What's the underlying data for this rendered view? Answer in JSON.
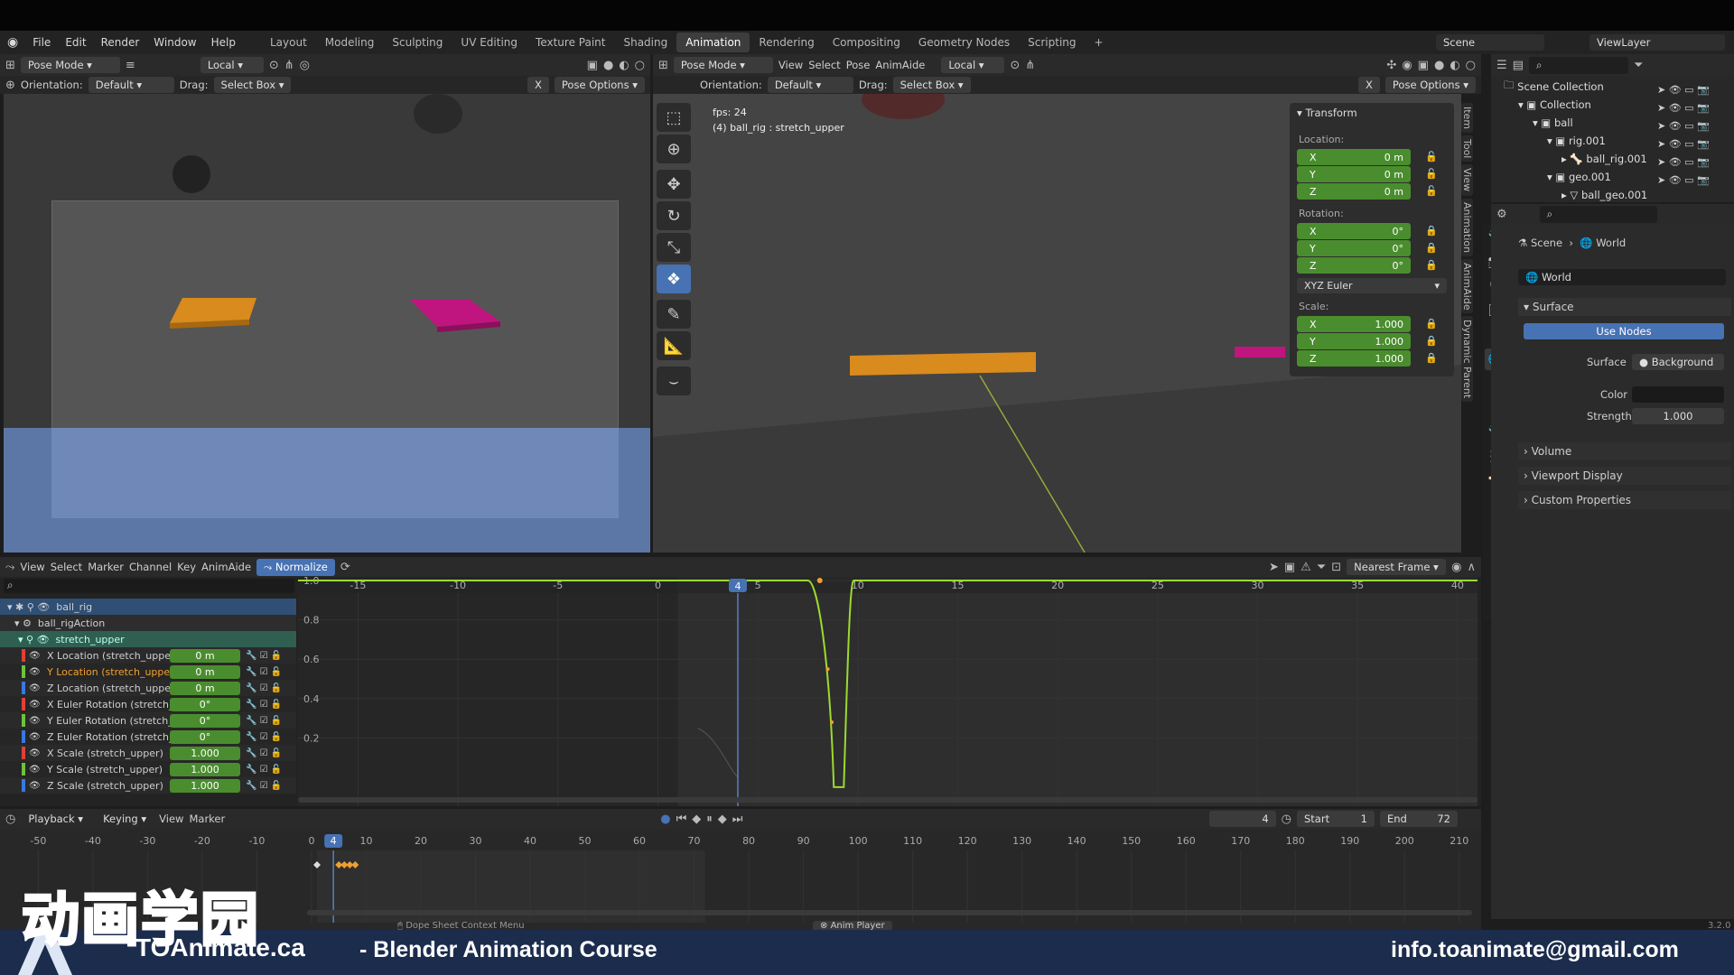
{
  "menubar": {
    "items": [
      "File",
      "Edit",
      "Render",
      "Window",
      "Help"
    ],
    "workspaces": [
      "Layout",
      "Modeling",
      "Sculpting",
      "UV Editing",
      "Texture Paint",
      "Shading",
      "Animation",
      "Rendering",
      "Compositing",
      "Geometry Nodes",
      "Scripting"
    ],
    "active_workspace": "Animation",
    "scene": "Scene",
    "view_layer": "ViewLayer",
    "plus": "+"
  },
  "left_viewport": {
    "mode": "Pose Mode",
    "transform": "Local",
    "orientation_label": "Orientation:",
    "orientation": "Default",
    "drag_label": "Drag:",
    "drag": "Select Box",
    "pose_options": "Pose Options",
    "axis": "X"
  },
  "right_viewport": {
    "mode": "Pose Mode",
    "menus": [
      "View",
      "Select",
      "Pose",
      "AnimAide"
    ],
    "transform": "Local",
    "orientation_label": "Orientation:",
    "orientation": "Default",
    "drag_label": "Drag:",
    "drag": "Select Box",
    "pose_options": "Pose Options",
    "axis": "X",
    "overlay_fps": "fps: 24",
    "overlay_obj": "(4) ball_rig : stretch_upper"
  },
  "transform_panel": {
    "title": "Transform",
    "location_label": "Location:",
    "rotation_label": "Rotation:",
    "scale_label": "Scale:",
    "location": [
      {
        "axis": "X",
        "value": "0 m"
      },
      {
        "axis": "Y",
        "value": "0 m"
      },
      {
        "axis": "Z",
        "value": "0 m"
      }
    ],
    "rotation": [
      {
        "axis": "X",
        "value": "0°"
      },
      {
        "axis": "Y",
        "value": "0°"
      },
      {
        "axis": "Z",
        "value": "0°"
      }
    ],
    "rotation_mode": "XYZ Euler",
    "scale": [
      {
        "axis": "X",
        "value": "1.000"
      },
      {
        "axis": "Y",
        "value": "1.000"
      },
      {
        "axis": "Z",
        "value": "1.000"
      }
    ]
  },
  "side_tabs": [
    "Item",
    "Tool",
    "View",
    "Animation",
    "AnimAide",
    "Dynamic Parent"
  ],
  "outliner": {
    "root": "Scene Collection",
    "rows": [
      "Collection",
      "ball",
      "rig.001",
      "ball_rig.001",
      "geo.001",
      "ball_geo.001"
    ]
  },
  "properties": {
    "breadcrumb_scene": "Scene",
    "breadcrumb_world": "World",
    "world_name": "World",
    "surface_section": "Surface",
    "use_nodes": "Use Nodes",
    "surface_label": "Surface",
    "surface_value": "Background",
    "color_label": "Color",
    "strength_label": "Strength",
    "strength_value": "1.000",
    "sections": [
      "Volume",
      "Viewport Display",
      "Custom Properties"
    ],
    "version": "3.2.0"
  },
  "graph_editor": {
    "menus": [
      "View",
      "Select",
      "Marker",
      "Channel",
      "Key",
      "AnimAide"
    ],
    "normalize": "Normalize",
    "snap": "Nearest Frame",
    "frame_ticks": [
      "-15",
      "-10",
      "-5",
      "0",
      "5",
      "10",
      "15",
      "20",
      "25",
      "30",
      "35",
      "40"
    ],
    "current_frame": "4",
    "y_ticks": [
      "1.0",
      "0.8",
      "0.6",
      "0.4",
      "0.2"
    ],
    "channels": {
      "rig": "ball_rig",
      "action": "ball_rigAction",
      "group": "stretch_upper",
      "items": [
        {
          "name": "X Location (stretch_upper)",
          "value": "0 m",
          "color": "#e0403a"
        },
        {
          "name": "Y Location (stretch_upper)",
          "value": "0 m",
          "color": "#6ec23c"
        },
        {
          "name": "Z Location (stretch_upper)",
          "value": "0 m",
          "color": "#3a78e0"
        },
        {
          "name": "X Euler Rotation (stretch_up",
          "value": "0°",
          "color": "#e0403a"
        },
        {
          "name": "Y Euler Rotation (stretch_up",
          "value": "0°",
          "color": "#6ec23c"
        },
        {
          "name": "Z Euler Rotation (stretch_up",
          "value": "0°",
          "color": "#3a78e0"
        },
        {
          "name": "X Scale (stretch_upper)",
          "value": "1.000",
          "color": "#e0403a"
        },
        {
          "name": "Y Scale (stretch_upper)",
          "value": "1.000",
          "color": "#6ec23c"
        },
        {
          "name": "Z Scale (stretch_upper)",
          "value": "1.000",
          "color": "#3a78e0"
        }
      ]
    }
  },
  "timeline": {
    "menus": [
      "Playback",
      "Keying",
      "View",
      "Marker"
    ],
    "frame": "4",
    "start_label": "Start",
    "start": "1",
    "end_label": "End",
    "end": "72",
    "ticks": [
      "-50",
      "-40",
      "-30",
      "-20",
      "-10",
      "0",
      "10",
      "20",
      "30",
      "40",
      "50",
      "60",
      "70",
      "80",
      "90",
      "100",
      "110",
      "120",
      "130",
      "140",
      "150",
      "160",
      "170",
      "180",
      "190",
      "200",
      "210"
    ],
    "status_left": "Dope Sheet Context Menu",
    "status_right": "Anim Player"
  },
  "footer": {
    "logo_cn": "动画学园",
    "brand": "TOAnimate.ca",
    "course": "- Blender Animation Course",
    "email": "info.toanimate@gmail.com"
  },
  "colors": {
    "accent": "#4772b3",
    "field_green": "#4a8d2e",
    "curve": "#9bdb2e",
    "footer_bg": "#1c2c4d"
  }
}
